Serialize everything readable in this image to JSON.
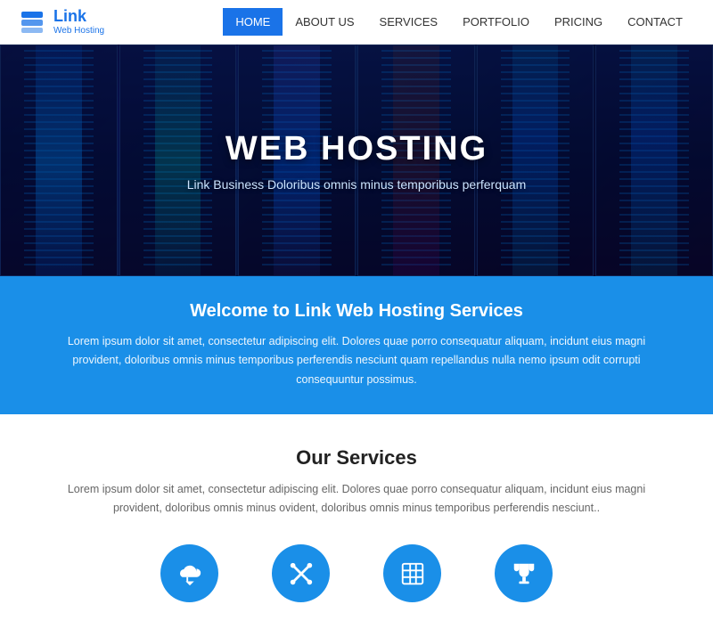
{
  "header": {
    "logo_text": "Link",
    "logo_sub": "Web Hosting",
    "nav": [
      {
        "label": "HOME",
        "active": true
      },
      {
        "label": "ABOUT US",
        "active": false
      },
      {
        "label": "SERVICES",
        "active": false
      },
      {
        "label": "PORTFOLIO",
        "active": false
      },
      {
        "label": "PRICING",
        "active": false
      },
      {
        "label": "CONTACT",
        "active": false
      }
    ]
  },
  "hero": {
    "title": "WEB HOSTING",
    "subtitle": "Link Business Doloribus omnis minus temporibus perferquam"
  },
  "blue_section": {
    "heading": "Welcome to Link Web Hosting Services",
    "body": "Lorem ipsum dolor sit amet, consectetur adipiscing elit. Dolores quae porro consequatur aliquam, incidunt eius magni provident, doloribus omnis minus temporibus perferendis nesciunt quam repellandus nulla nemo ipsum odit corrupti consequuntur possimus."
  },
  "services_section": {
    "heading": "Our Services",
    "body": "Lorem ipsum dolor sit amet, consectetur adipiscing elit. Dolores quae porro consequatur aliquam, incidunt eius magni provident, doloribus omnis minus ovident, doloribus omnis minus temporibus perferendis nesciunt..",
    "icons": [
      {
        "name": "cloud-upload-icon",
        "symbol": "☁"
      },
      {
        "name": "tools-icon",
        "symbol": "✂"
      },
      {
        "name": "grid-icon",
        "symbol": "▦"
      },
      {
        "name": "trophy-icon",
        "symbol": "🏆"
      }
    ]
  }
}
